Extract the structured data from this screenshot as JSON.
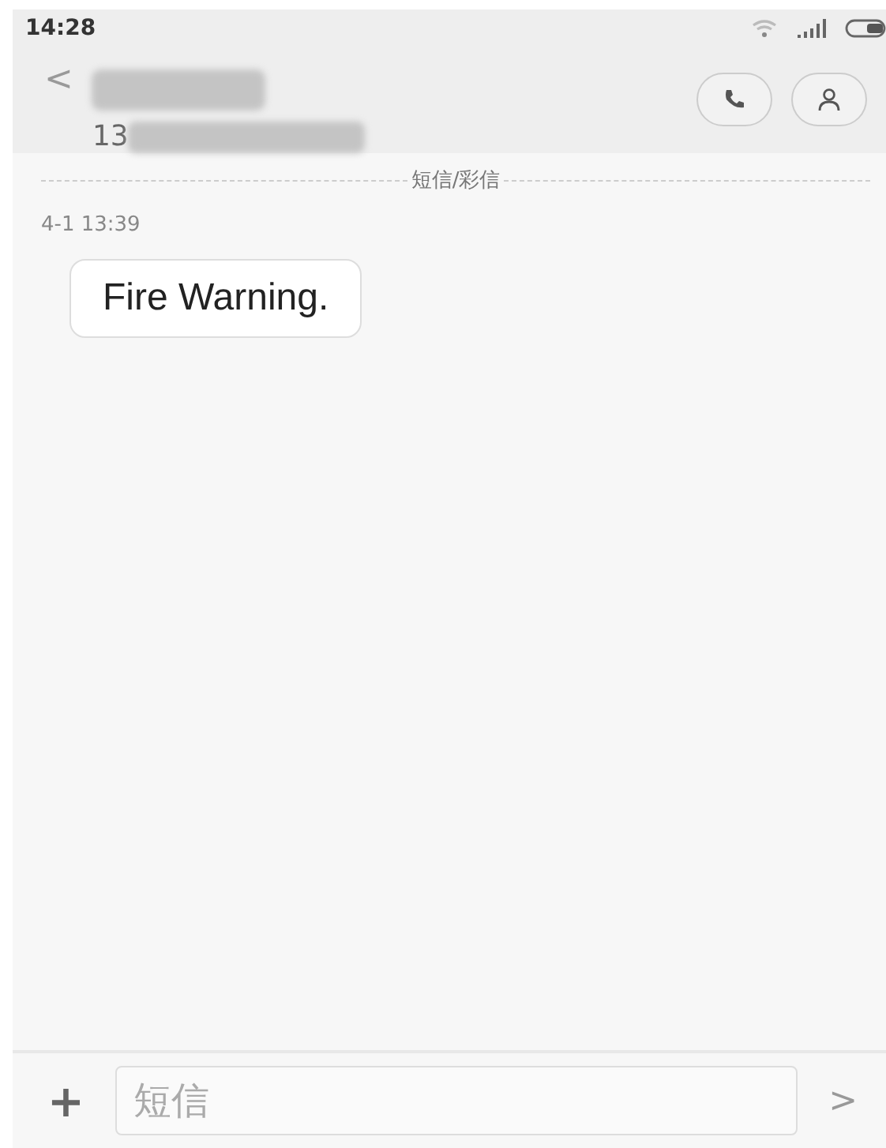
{
  "status_bar": {
    "time": "14:28"
  },
  "header": {
    "back": "<",
    "number": "13"
  },
  "thread": {
    "divider": "短信/彩信",
    "timestamp": "4-1 13:39",
    "messages": [
      {
        "text": "Fire Warning.",
        "kind": "incoming"
      }
    ]
  },
  "composer": {
    "add": "+",
    "placeholder": "短信",
    "send": ">",
    "send_disabled": true
  }
}
